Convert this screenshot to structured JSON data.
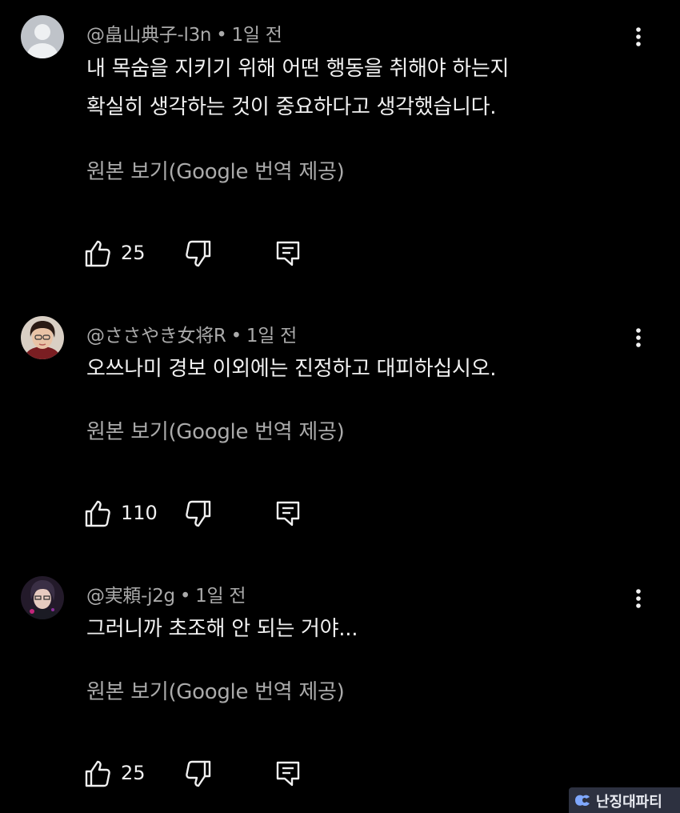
{
  "comments": [
    {
      "author": "@畠山典子-l3n",
      "time": "1일 전",
      "text_lines": [
        "내 목숨을 지키기 위해 어떤 행동을 취해야 하는지",
        "확실히 생각하는 것이 중요하다고 생각했습니다."
      ],
      "translate_label": "원본 보기(Google 번역 제공)",
      "likes": "25"
    },
    {
      "author": "@ささやき女将R",
      "time": "1일 전",
      "text_lines": [
        "오쓰나미 경보 이외에는 진정하고 대피하십시오."
      ],
      "translate_label": "원본 보기(Google 번역 제공)",
      "likes": "110"
    },
    {
      "author": "@実頼-j2g",
      "time": "1일 전",
      "text_lines": [
        "그러니까 초조해 안 되는 거야..."
      ],
      "translate_label": "원본 보기(Google 번역 제공)",
      "likes": "25"
    }
  ],
  "meta_separator": "•",
  "icons": {
    "like": "thumbs-up-icon",
    "dislike": "thumbs-down-icon",
    "reply": "reply-icon",
    "menu": "more-vert-icon"
  },
  "watermark": {
    "text": "난징대파티"
  },
  "colors": {
    "background": "#000000",
    "primary_text": "#f1f1f1",
    "secondary_text": "#aaaaaa"
  }
}
